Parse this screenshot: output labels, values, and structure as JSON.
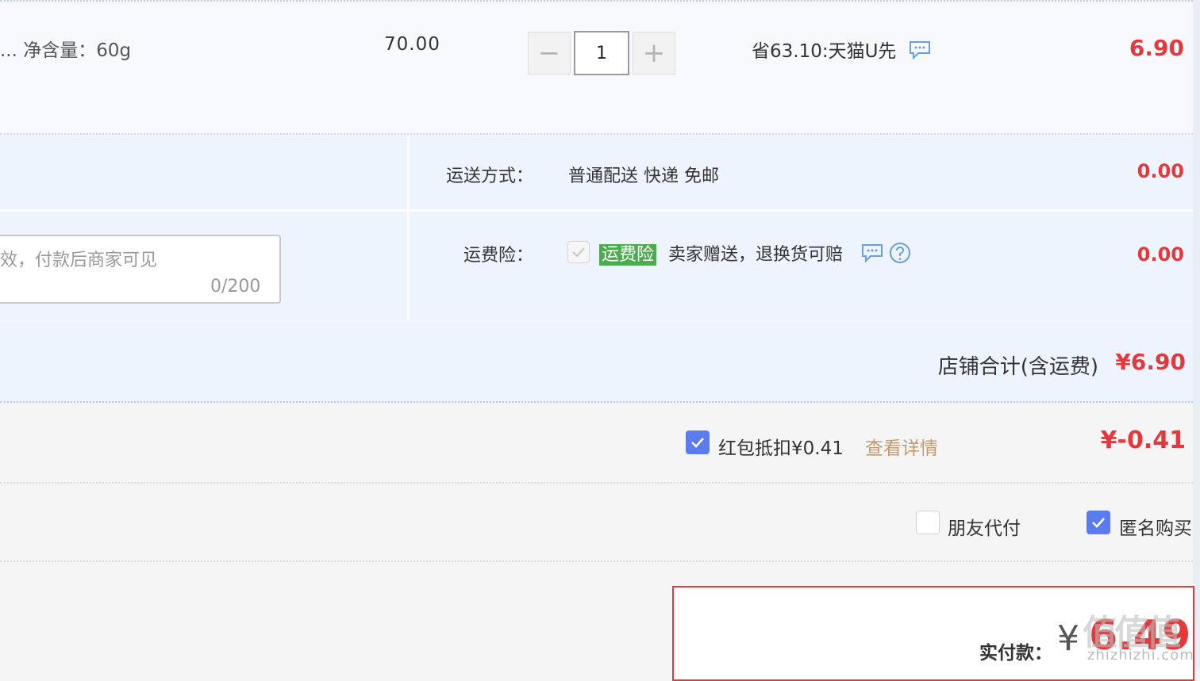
{
  "item": {
    "weight_text": "...   净含量：60g",
    "unit_price": "70.00",
    "quantity": "1",
    "decrement_symbol": "−",
    "increment_symbol": "+",
    "promo_text": "省63.10:天猫U先",
    "subtotal": "6.90"
  },
  "shipping": {
    "method_label": "运送方式：",
    "method_value": "普通配送  快递  免邮",
    "method_amount": "0.00",
    "insurance_label": "运费险：",
    "insurance_tag": "运费险",
    "insurance_desc": "卖家赠送，退换货可赔",
    "insurance_amount": "0.00"
  },
  "memo": {
    "placeholder": "效，付款后商家可见",
    "counter": "0/200"
  },
  "shop_total": {
    "label": "店铺合计(含运费)",
    "amount": "¥6.90"
  },
  "red_packet": {
    "label": "红包抵扣¥0.41",
    "details_link": "查看详情",
    "amount": "¥-0.41",
    "checked": true
  },
  "options": {
    "friend_pay_label": "朋友代付",
    "friend_pay_checked": false,
    "anonymous_label": "匿名购买",
    "anonymous_checked": true
  },
  "payment": {
    "label": "实付款：",
    "currency": "¥",
    "amount": "6.49"
  },
  "watermark": {
    "chars": "值值值",
    "domain": "zhizhizhi.com"
  },
  "colors": {
    "price_red": "#e4393c",
    "checkbox_blue": "#5b7cef",
    "insurance_green": "#4caa4f",
    "link_gold": "#c49a6c"
  }
}
